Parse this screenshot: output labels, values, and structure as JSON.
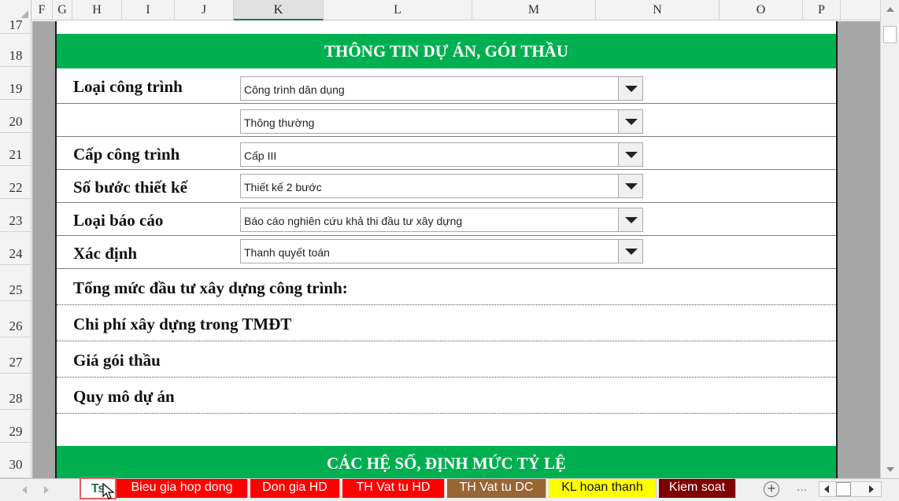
{
  "columns": [
    "F",
    "G",
    "H",
    "I",
    "J",
    "K",
    "L",
    "M",
    "N",
    "O",
    "P"
  ],
  "selected_column": "K",
  "rows": [
    "17",
    "18",
    "19",
    "20",
    "21",
    "22",
    "23",
    "24",
    "25",
    "26",
    "27",
    "28",
    "29",
    "30"
  ],
  "sections": {
    "project_info_title": "THÔNG TIN DỰ ÁN, GÓI THẦU",
    "coefficients_title": "CÁC HỆ SỐ, ĐỊNH MỨC TỶ LỆ"
  },
  "fields": {
    "loai_cong_trinh": {
      "label": "Loại công trình",
      "value": "Công trình dân dụng"
    },
    "loai_phu": {
      "value": "Thông thường"
    },
    "cap_cong_trinh": {
      "label": "Cấp công trình",
      "value": "Cấp III"
    },
    "so_buoc_thiet_ke": {
      "label": "Số bước thiết kế",
      "value": "Thiết kế 2 bước"
    },
    "loai_bao_cao": {
      "label": "Loại báo cáo",
      "value": "Báo cáo nghiên cứu khả thi đầu tư xây dựng"
    },
    "xac_dinh": {
      "label": "Xác định",
      "value": "Thanh quyết toán"
    }
  },
  "plain_labels": {
    "tong_muc": "Tổng mức đầu tư xây dựng công trình:",
    "chi_phi": "Chi phí xây dựng trong TMĐT",
    "gia_goi_thau": "Giá gói thầu",
    "quy_mo": "Quy mô dự án"
  },
  "sheet_tabs": [
    {
      "label": "Ts",
      "color": "#ffffff",
      "text_color": "#217346",
      "active": true
    },
    {
      "label": "Bieu gia hop dong",
      "color": "#ff0000",
      "text_color": "#ffffff",
      "active": false
    },
    {
      "label": "Don gia HD",
      "color": "#ff0000",
      "text_color": "#ffffff",
      "active": false
    },
    {
      "label": "TH Vat tu HD",
      "color": "#ff0000",
      "text_color": "#ffffff",
      "active": false
    },
    {
      "label": "TH Vat tu DC",
      "color": "#996633",
      "text_color": "#ffffff",
      "active": false
    },
    {
      "label": "KL hoan thanh",
      "color": "#ffff00",
      "text_color": "#111111",
      "active": false
    },
    {
      "label": "Kiem soat",
      "color": "#800000",
      "text_color": "#ffffff",
      "active": false
    }
  ],
  "tab_more": "...",
  "add_sheet": "+",
  "colors": {
    "section_banner": "#00b050",
    "excel_green": "#217346"
  },
  "icons": {
    "dropdown": "chevron-down-icon",
    "add_sheet": "plus-circle-icon",
    "cursor": "mouse-pointer-icon"
  }
}
